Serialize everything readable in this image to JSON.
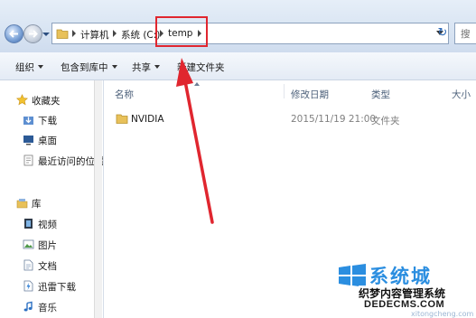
{
  "address_bar": {
    "breadcrumbs": [
      "计算机",
      "系统 (C:)",
      "temp"
    ],
    "search_placeholder": "搜"
  },
  "toolbar": {
    "organize": "组织",
    "include_in_library": "包含到库中",
    "share": "共享",
    "new_folder": "新建文件夹"
  },
  "nav": {
    "favorites_header": "收藏夹",
    "favorites": [
      "下载",
      "桌面",
      "最近访问的位置"
    ],
    "libraries_header": "库",
    "libraries": [
      "视频",
      "图片",
      "文档",
      "迅雷下载",
      "音乐"
    ]
  },
  "columns": {
    "name": "名称",
    "date_modified": "修改日期",
    "type": "类型",
    "size": "大小"
  },
  "files": [
    {
      "name": "NVIDIA",
      "date_modified": "2015/11/19 21:00",
      "type": "文件夹",
      "icon": "folder-icon"
    }
  ],
  "annotation": {
    "highlight_color": "#e0262f",
    "arrow_color": "#e0262f"
  },
  "watermark": {
    "brand": "系统城",
    "line1": "织梦内容管理系统",
    "line2": "DEDECMS.COM",
    "faint": "xitongcheng.com"
  },
  "colors": {
    "accent": "#2b8ee0",
    "header_text": "#4c607a",
    "folder": "#e8c15a"
  }
}
